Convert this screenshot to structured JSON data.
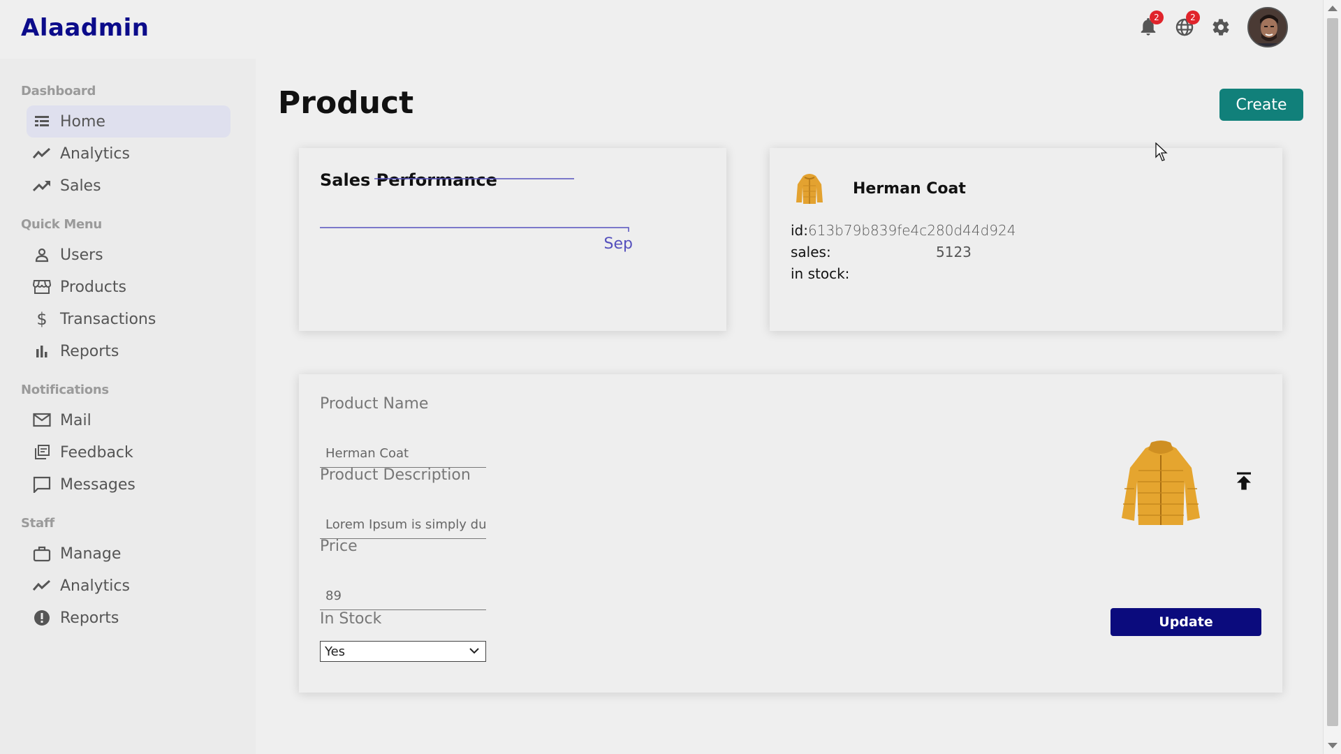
{
  "app": {
    "logo": "Alaadmin"
  },
  "topbar": {
    "notifications_count": "2",
    "language_count": "2",
    "icons": [
      "bell-icon",
      "globe-icon",
      "gear-icon",
      "user-avatar"
    ]
  },
  "sidebar": {
    "sections": [
      {
        "title": "Dashboard",
        "items": [
          {
            "label": "Home",
            "icon": "home-icon",
            "active": true
          },
          {
            "label": "Analytics",
            "icon": "trend-line-icon"
          },
          {
            "label": "Sales",
            "icon": "trending-up-icon"
          }
        ]
      },
      {
        "title": "Quick Menu",
        "items": [
          {
            "label": "Users",
            "icon": "person-icon"
          },
          {
            "label": "Products",
            "icon": "store-icon"
          },
          {
            "label": "Transactions",
            "icon": "dollar-icon"
          },
          {
            "label": "Reports",
            "icon": "bar-chart-icon"
          }
        ]
      },
      {
        "title": "Notifications",
        "items": [
          {
            "label": "Mail",
            "icon": "mail-icon"
          },
          {
            "label": "Feedback",
            "icon": "feedback-icon"
          },
          {
            "label": "Messages",
            "icon": "chat-icon"
          }
        ]
      },
      {
        "title": "Staff",
        "items": [
          {
            "label": "Manage",
            "icon": "briefcase-icon"
          },
          {
            "label": "Analytics",
            "icon": "trend-line-icon"
          },
          {
            "label": "Reports",
            "icon": "alert-circle-icon"
          }
        ]
      }
    ]
  },
  "main": {
    "title": "Product",
    "create_label": "Create"
  },
  "chart_data": {
    "type": "line",
    "title": "Sales Performance",
    "categories": [
      "Sep"
    ],
    "series": [
      {
        "values": [
          1
        ]
      }
    ],
    "xlabel": "",
    "ylabel": "",
    "grid": false,
    "color": "#5550bd"
  },
  "info": {
    "name": "Herman Coat",
    "id_label": "id:",
    "id_value": "613b79b839fe4c280d44d924",
    "sales_label": "sales:",
    "sales_value": "5123",
    "stock_label": "in stock:",
    "stock_value": ""
  },
  "form": {
    "name_label": "Product Name",
    "name_value": "Herman Coat",
    "desc_label": "Product Description",
    "desc_value": "Lorem Ipsum is simply dummy text",
    "price_label": "Price",
    "price_value": "89",
    "stock_label": "In Stock",
    "stock_selected": "Yes",
    "update_label": "Update"
  },
  "colors": {
    "brand": "#0b0b8a",
    "create": "#11807a",
    "update": "#0b0b7d",
    "badge": "#e0242b",
    "chart": "#5550bd"
  }
}
